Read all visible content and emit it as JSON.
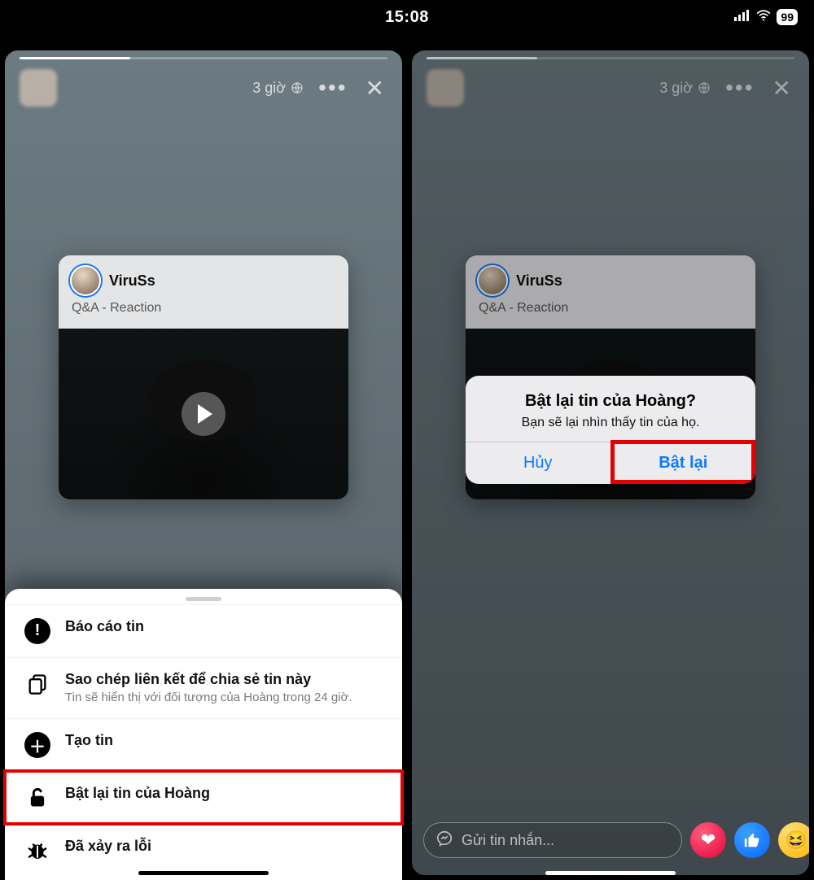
{
  "status": {
    "time": "15:08",
    "battery": "99"
  },
  "story": {
    "timestamp": "3 giờ",
    "card": {
      "name": "ViruSs",
      "subtitle": "Q&A - Reaction"
    }
  },
  "sheet": {
    "items": [
      {
        "icon": "alert",
        "title": "Báo cáo tin",
        "desc": ""
      },
      {
        "icon": "copy",
        "title": "Sao chép liên kết để chia sẻ tin này",
        "desc": "Tin sẽ hiển thị với đối tượng của Hoàng trong 24 giờ."
      },
      {
        "icon": "plus",
        "title": "Tạo tin",
        "desc": ""
      },
      {
        "icon": "unlock",
        "title": "Bật lại tin của Hoàng",
        "desc": "",
        "highlight": true
      },
      {
        "icon": "bug",
        "title": "Đã xảy ra lỗi",
        "desc": ""
      }
    ]
  },
  "confirm": {
    "title": "Bật lại tin của Hoàng?",
    "message": "Bạn sẽ lại nhìn thấy tin của họ.",
    "cancel": "Hủy",
    "ok": "Bật lại"
  },
  "reply": {
    "placeholder": "Gửi tin nhắn..."
  }
}
